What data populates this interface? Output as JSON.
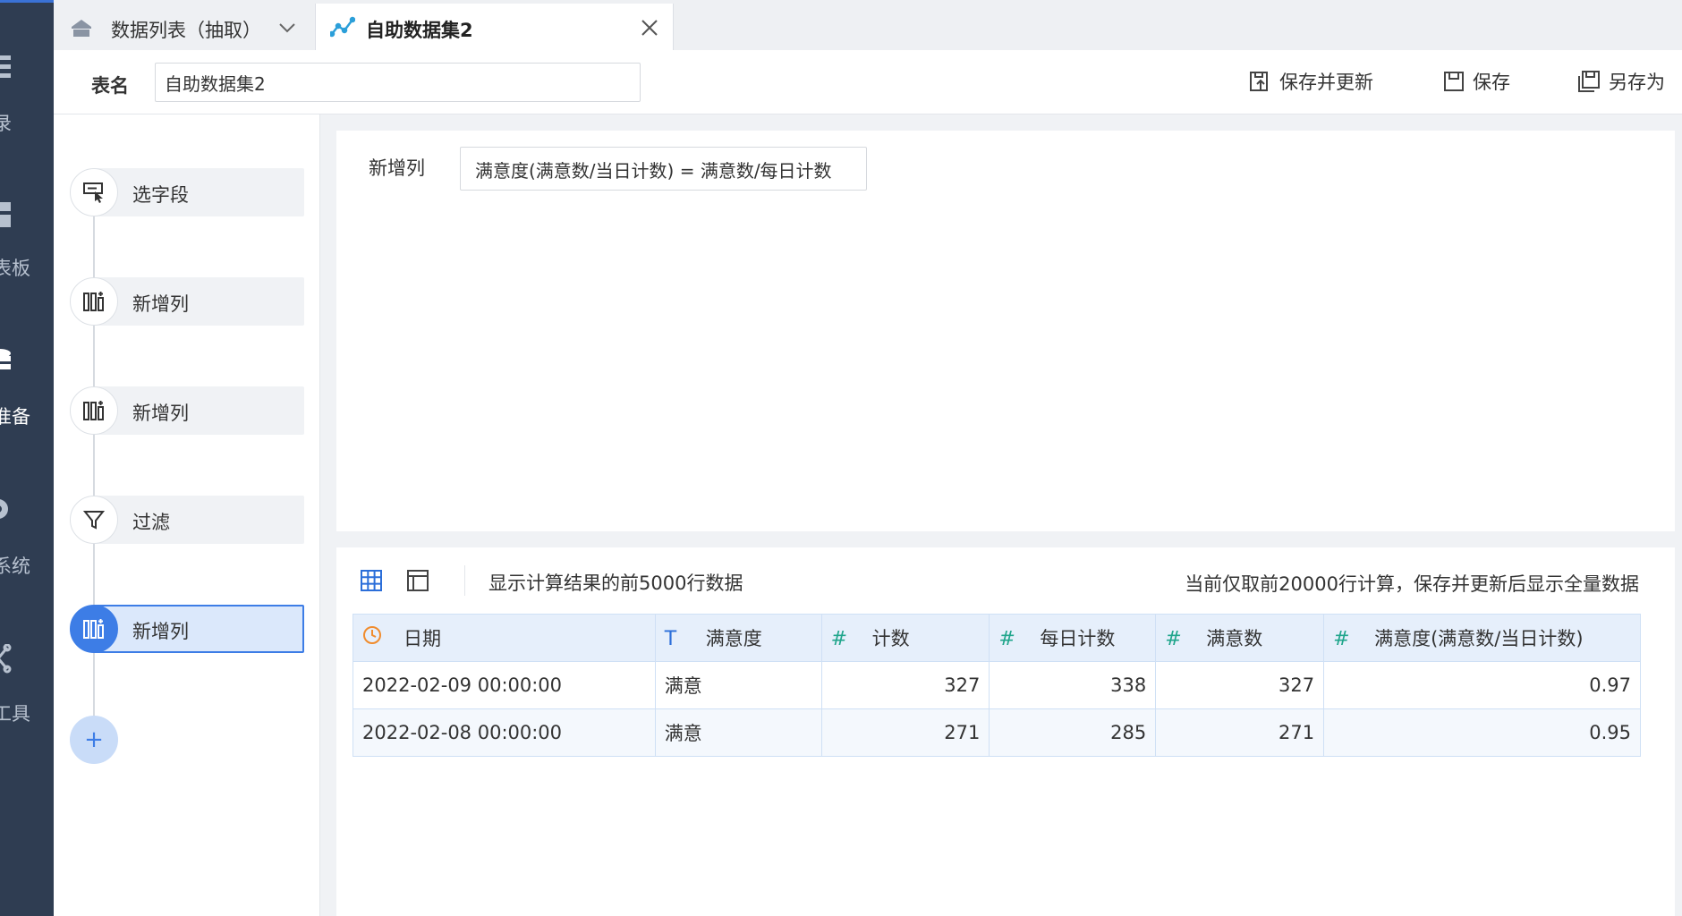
{
  "nav": {
    "items": [
      {
        "label": "录"
      },
      {
        "label": "表板"
      },
      {
        "label": "准备"
      },
      {
        "label": "系统"
      },
      {
        "label": "工具"
      }
    ]
  },
  "tabs": [
    {
      "label": "数据列表（抽取）",
      "icon": "home-icon"
    },
    {
      "label": "自助数据集2",
      "icon": "line-chart-icon"
    }
  ],
  "header": {
    "table_name_label": "表名",
    "table_name_value": "自助数据集2",
    "save_update_label": "保存并更新",
    "save_label": "保存",
    "save_as_label": "另存为"
  },
  "steps": [
    {
      "label": "选字段",
      "icon": "select-field-icon"
    },
    {
      "label": "新增列",
      "icon": "add-column-icon"
    },
    {
      "label": "新增列",
      "icon": "add-column-icon"
    },
    {
      "label": "过滤",
      "icon": "filter-icon"
    },
    {
      "label": "新增列",
      "icon": "add-column-icon",
      "active": true
    }
  ],
  "add_step_label": "+",
  "formula": {
    "label": "新增列",
    "expression": "满意度(满意数/当日计数) = 满意数/每日计数"
  },
  "preview": {
    "left_text": "显示计算结果的前5000行数据",
    "right_text": "当前仅取前20000行计算，保存并更新后显示全量数据",
    "columns": [
      {
        "icon": "clock-icon",
        "label": "日期"
      },
      {
        "icon": "text-icon",
        "label": "满意度"
      },
      {
        "icon": "hash-icon",
        "label": "计数"
      },
      {
        "icon": "hash-icon",
        "label": "每日计数"
      },
      {
        "icon": "hash-icon",
        "label": "满意数"
      },
      {
        "icon": "hash-icon",
        "label": "满意度(满意数/当日计数)"
      }
    ],
    "rows": [
      [
        "2022-02-09 00:00:00",
        "满意",
        "327",
        "338",
        "327",
        "0.97"
      ],
      [
        "2022-02-08 00:00:00",
        "满意",
        "271",
        "285",
        "271",
        "0.95"
      ]
    ]
  },
  "colors": {
    "nav_bg": "#2f3d52",
    "accent": "#3d7de6",
    "header_bg": "#e6effb"
  }
}
